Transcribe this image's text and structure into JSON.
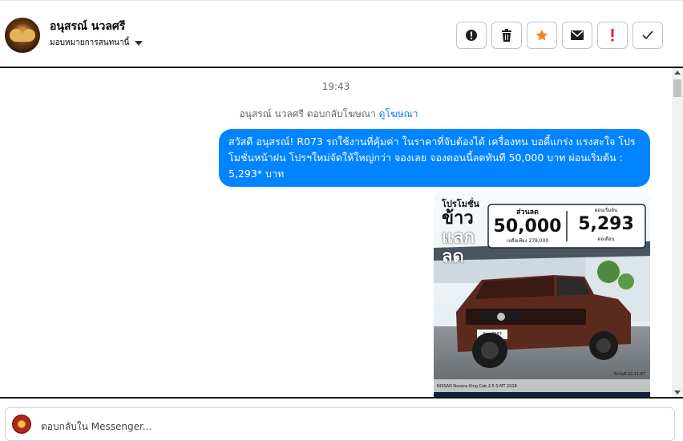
{
  "header": {
    "contact_name": "อนุสรณ์ นวลศรี",
    "assign_label": "มอบหมายการสนทนานี้",
    "actions": [
      {
        "name": "report-spam",
        "icon": "alert-circle-icon"
      },
      {
        "name": "delete",
        "icon": "trash-icon"
      },
      {
        "name": "star",
        "icon": "star-icon"
      },
      {
        "name": "mark-unread",
        "icon": "envelope-icon"
      },
      {
        "name": "important",
        "icon": "exclamation-icon"
      },
      {
        "name": "done",
        "icon": "check-icon"
      }
    ]
  },
  "chat": {
    "time": "19:43",
    "reply_note_prefix": "อนุสรณ์ นวลศรี ตอบกลับโฆษณา",
    "reply_note_link": "ดูโฆษณา",
    "message": "สวัสดี อนุสรณ์! R073 รถใช้งานที่คุ้มค่า ในราคาที่จับต้องได้ เครื่องทน บอดี้แกร่ง แรงสะใจ โปรโมชั่นหน้าฝน โปรฯใหม่จัดให้ใหญ่กว่า จองเลย จองตอนนี้ลดทันที 50,000 บาท ผ่อนเริ่มต้น : 5,293* บาท",
    "ad": {
      "promo_line1": "โปรโมชั่น",
      "promo_line2": "ข้าว",
      "promo_line3": "แลก",
      "promo_line4": "ลด",
      "discount_label": "ส่วนลด",
      "discount_value": "50,000",
      "discount_note": "เหลือเพียง 279,000",
      "installment_label": "ผ่อนเริ่มต้น",
      "installment_value": "5,293",
      "installment_note": "ต่อเดือน",
      "plate": "3กษ 3587",
      "caption": "NISSAN Navara King Cab 2.5 S MT 2018",
      "date_note": "ถึงวันที่ 22.11.67"
    }
  },
  "composer": {
    "placeholder": "ตอบกลับใน Messenger..."
  },
  "colors": {
    "bubble": "#0084ff",
    "star": "#f5821f",
    "important": "#e41e3f",
    "link": "#1877f2"
  }
}
